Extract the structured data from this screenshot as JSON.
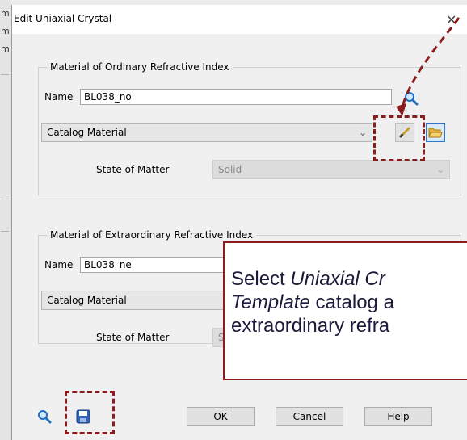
{
  "background": {
    "strip_letters": [
      "m",
      "m",
      "m"
    ]
  },
  "dialog": {
    "title": "Edit Uniaxial Crystal",
    "close_glyph": "✕"
  },
  "ordinary": {
    "legend": "Material of Ordinary Refractive Index",
    "name_label": "Name",
    "name_value": "BL038_no",
    "source": "Catalog Material",
    "state_label": "State of Matter",
    "state_value": "Solid"
  },
  "extraordinary": {
    "legend": "Material of Extraordinary Refractive Index",
    "name_label": "Name",
    "name_value": "BL038_ne",
    "source": "Catalog Material",
    "state_label": "State of Matter",
    "state_value": "Soli"
  },
  "buttons": {
    "ok": "OK",
    "cancel": "Cancel",
    "help": "Help"
  },
  "callout": {
    "line1_prefix": "Select ",
    "line1_italic": "Uniaxial Cr",
    "line2_italic": "Template",
    "line2_rest": " catalog a",
    "line3": "extraordinary refra"
  },
  "colors": {
    "annotation": "#8a1c1c",
    "dialog_bg": "#f0f0f0"
  },
  "icons": [
    "search-icon",
    "edit-pencil-icon",
    "open-folder-icon",
    "save-icon",
    "close-icon",
    "chevron-down-icon"
  ]
}
